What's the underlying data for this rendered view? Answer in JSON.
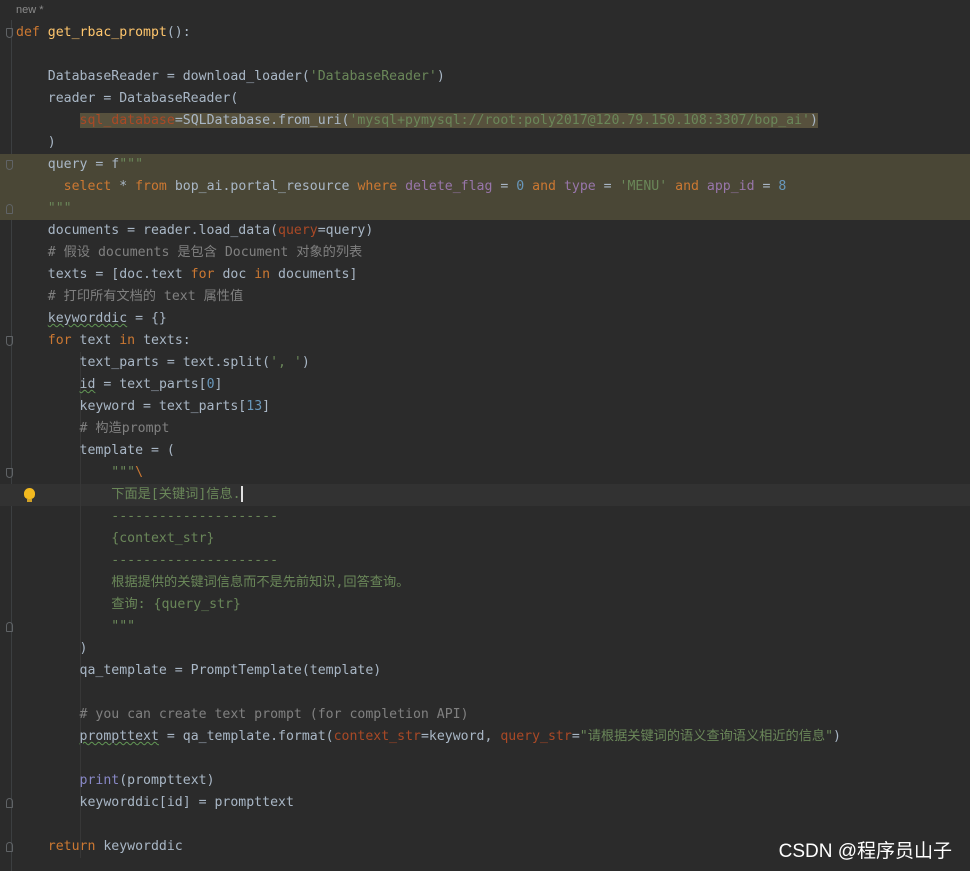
{
  "tab": {
    "title": "new *"
  },
  "watermark": "CSDN @程序员山子",
  "lines": [
    [
      [
        "kw",
        "def "
      ],
      [
        "fn",
        "get_rbac_prompt"
      ],
      [
        "p",
        "():"
      ]
    ],
    [],
    [
      [
        "p",
        "    DatabaseReader = download_loader("
      ],
      [
        "str",
        "'DatabaseReader'"
      ],
      [
        "p",
        ")"
      ]
    ],
    [
      [
        "p",
        "    reader = DatabaseReader("
      ]
    ],
    [
      [
        "p",
        "        "
      ],
      [
        "param sqlp",
        "sql_database"
      ],
      [
        "sqlp",
        "=SQLDatabase.from_uri("
      ],
      [
        "str sqlp",
        "'mysql+pymysql://root:poly2017@120.79.150.108:3307/bop_ai'"
      ],
      [
        "sqlp",
        ")"
      ]
    ],
    [
      [
        "p",
        "    )"
      ]
    ],
    [
      [
        "p",
        "    query = f"
      ],
      [
        "str",
        "\"\"\""
      ]
    ],
    [
      [
        "p",
        "      "
      ],
      [
        "kw",
        "select"
      ],
      [
        "p",
        " * "
      ],
      [
        "kw",
        "from"
      ],
      [
        "p",
        " bop_ai.portal_resource "
      ],
      [
        "kw",
        "where"
      ],
      [
        "p",
        " "
      ],
      [
        "col",
        "delete_flag"
      ],
      [
        "p",
        " = "
      ],
      [
        "num",
        "0"
      ],
      [
        "p",
        " "
      ],
      [
        "kw",
        "and"
      ],
      [
        "p",
        " "
      ],
      [
        "col",
        "type"
      ],
      [
        "p",
        " = "
      ],
      [
        "str",
        "'MENU'"
      ],
      [
        "p",
        " "
      ],
      [
        "kw",
        "and"
      ],
      [
        "p",
        " "
      ],
      [
        "col",
        "app_id"
      ],
      [
        "p",
        " = "
      ],
      [
        "num",
        "8"
      ]
    ],
    [
      [
        "str",
        "    \"\"\""
      ]
    ],
    [
      [
        "p",
        "    documents = reader.load_data("
      ],
      [
        "param",
        "query"
      ],
      [
        "p",
        "=query)"
      ]
    ],
    [
      [
        "cmt",
        "    # 假设 documents 是包含 Document 对象的列表"
      ]
    ],
    [
      [
        "p",
        "    texts = [doc.text "
      ],
      [
        "kw",
        "for"
      ],
      [
        "p",
        " doc "
      ],
      [
        "kw",
        "in"
      ],
      [
        "p",
        " documents]"
      ]
    ],
    [
      [
        "cmt",
        "    # 打印所有文档的 text 属性值"
      ]
    ],
    [
      [
        "p",
        "    "
      ],
      [
        "p wavy",
        "keyworddic"
      ],
      [
        "p",
        " = {}"
      ]
    ],
    [
      [
        "p",
        "    "
      ],
      [
        "kw",
        "for"
      ],
      [
        "p",
        " text "
      ],
      [
        "kw",
        "in"
      ],
      [
        "p",
        " texts:"
      ]
    ],
    [
      [
        "p",
        "        text_parts = text.split("
      ],
      [
        "str",
        "', '"
      ],
      [
        "p",
        ")"
      ]
    ],
    [
      [
        "p",
        "        "
      ],
      [
        "p wavy",
        "id"
      ],
      [
        "p",
        " = text_parts["
      ],
      [
        "num",
        "0"
      ],
      [
        "p",
        "]"
      ]
    ],
    [
      [
        "p",
        "        keyword = text_parts["
      ],
      [
        "num",
        "13"
      ],
      [
        "p",
        "]"
      ]
    ],
    [
      [
        "cmt",
        "        # 构造prompt"
      ]
    ],
    [
      [
        "p",
        "        template = ("
      ]
    ],
    [
      [
        "str",
        "            \"\"\""
      ],
      [
        "esc",
        "\\"
      ]
    ],
    [
      [
        "str",
        "            下面是[关键词]信息."
      ]
    ],
    [
      [
        "str",
        "            ---------------------"
      ]
    ],
    [
      [
        "str",
        "            {context_str}"
      ]
    ],
    [
      [
        "str",
        "            ---------------------"
      ]
    ],
    [
      [
        "str",
        "            根据提供的关键词信息而不是先前知识,回答查询。"
      ]
    ],
    [
      [
        "str",
        "            查询: {query_str}"
      ]
    ],
    [
      [
        "str",
        "            \"\"\""
      ]
    ],
    [
      [
        "p",
        "        )"
      ]
    ],
    [
      [
        "p",
        "        qa_template = PromptTemplate(template)"
      ]
    ],
    [],
    [
      [
        "cmt",
        "        # you can create text prompt (for completion API)"
      ]
    ],
    [
      [
        "p",
        "        "
      ],
      [
        "p wavy",
        "prompttext"
      ],
      [
        "p",
        " = qa_template.format("
      ],
      [
        "param",
        "context_str"
      ],
      [
        "p",
        "=keyword, "
      ],
      [
        "param",
        "query_str"
      ],
      [
        "p",
        "="
      ],
      [
        "str",
        "\"请根据关键词的语义查询语义相近的信息\""
      ],
      [
        "p",
        ")"
      ]
    ],
    [],
    [
      [
        "p",
        "        "
      ],
      [
        "builtin",
        "print"
      ],
      [
        "p",
        "(prompttext)"
      ]
    ],
    [
      [
        "p",
        "        keyworddic[id] = prompttext"
      ]
    ],
    [],
    [
      [
        "p",
        "    "
      ],
      [
        "kw",
        "return"
      ],
      [
        "p",
        " keyworddic"
      ]
    ]
  ]
}
